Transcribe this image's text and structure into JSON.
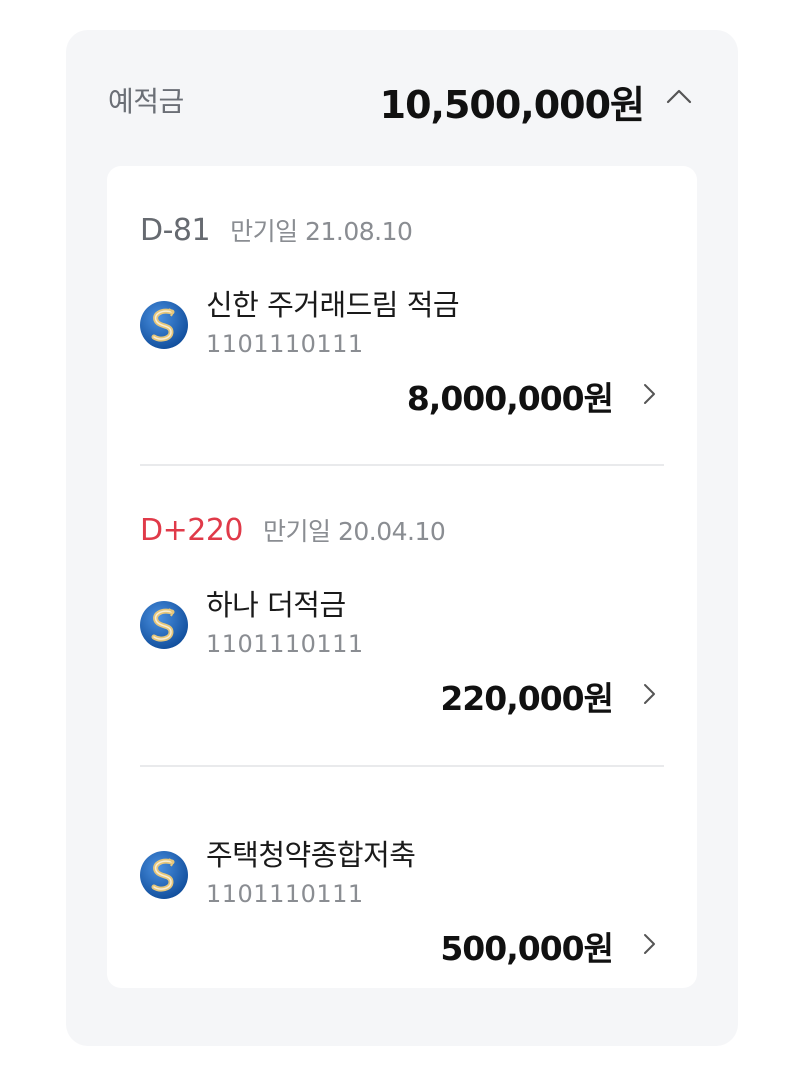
{
  "summary": {
    "label": "예적금",
    "total": "10,500,000원",
    "toggle_icon": "chevron-up-icon"
  },
  "accounts": [
    {
      "dday": "D-81",
      "maturity": "만기일 21.08.10",
      "name": "신한 주거래드림 적금",
      "account_number": "1101110111",
      "amount": "8,000,000원",
      "icon": "shinhan-bank-logo-icon",
      "dday_color": "#666a70"
    },
    {
      "dday": "D+220",
      "maturity": "만기일 20.04.10",
      "name": "하나 더적금",
      "account_number": "1101110111",
      "amount": "220,000원",
      "icon": "shinhan-bank-logo-icon",
      "dday_color": "#e03a49"
    },
    {
      "name": "주택청약종합저축",
      "account_number": "1101110111",
      "amount": "500,000원",
      "icon": "shinhan-bank-logo-icon"
    }
  ],
  "colors": {
    "panel_bg": "#f5f6f8",
    "card_bg": "#ffffff",
    "overdue": "#e03a49",
    "logo_blue": "#1b5fb0",
    "logo_gold": "#c8a35a"
  }
}
